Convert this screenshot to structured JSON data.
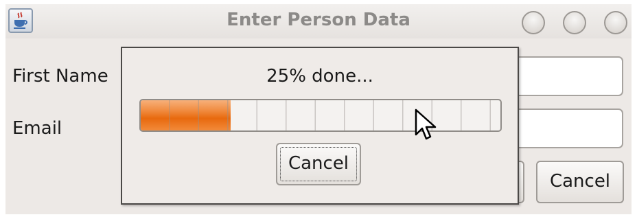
{
  "window": {
    "title": "Enter Person Data",
    "app_icon": "java-coffee-cup-icon"
  },
  "form": {
    "first_name_label": "First Name",
    "email_label": "Email",
    "first_name_value": "",
    "email_value": "",
    "cancel_label": "Cancel"
  },
  "progress_dialog": {
    "status_text": "25% done...",
    "progress_percent": 25,
    "cancel_label": "Cancel"
  },
  "colors": {
    "progress_fill": "#f07a24",
    "window_background": "#ede9e6"
  }
}
